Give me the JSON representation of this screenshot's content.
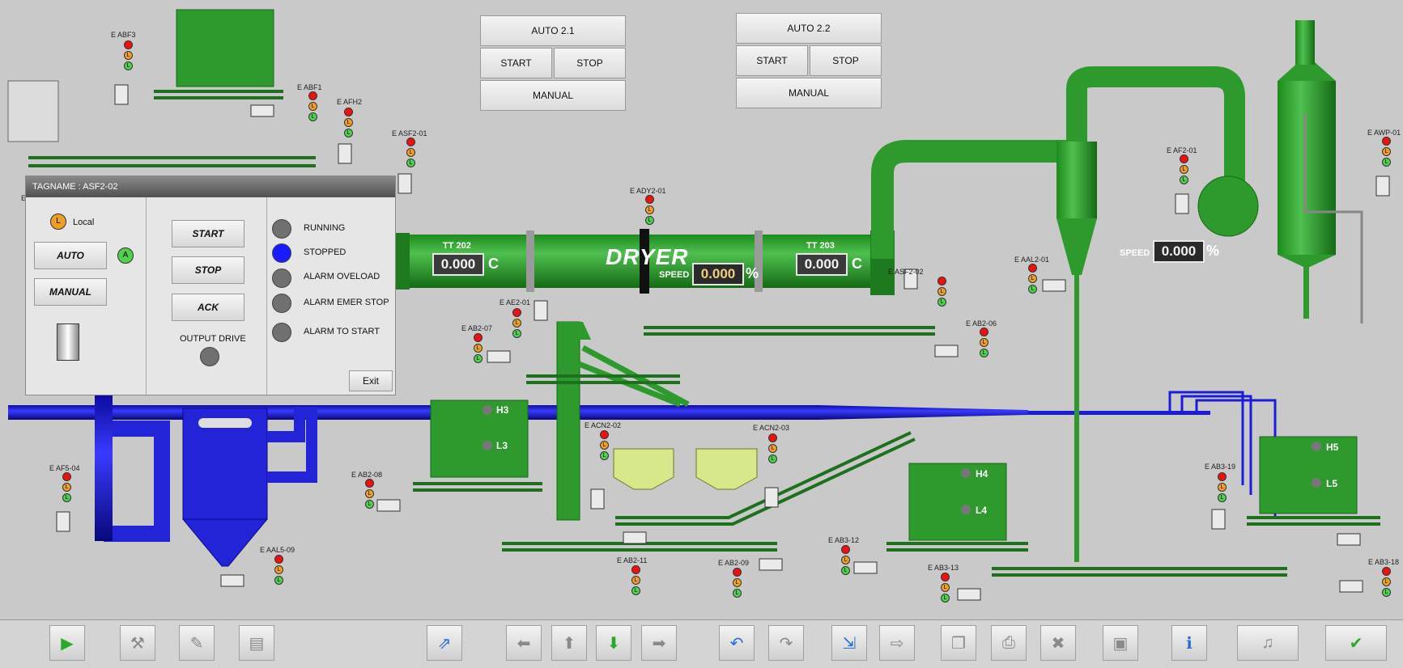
{
  "auto_panels": [
    {
      "title": "AUTO 2.1",
      "start": "START",
      "stop": "STOP",
      "manual": "MANUAL"
    },
    {
      "title": "AUTO 2.2",
      "start": "START",
      "stop": "STOP",
      "manual": "MANUAL"
    }
  ],
  "dryer": {
    "label": "DRYER",
    "speed_label": "SPEED",
    "speed_value": "0.000",
    "speed_unit": "%",
    "tt202": {
      "label": "TT 202",
      "value": "0.000",
      "unit": "C"
    },
    "tt203": {
      "label": "TT 203",
      "value": "0.000",
      "unit": "C"
    }
  },
  "fan_speed": {
    "label": "SPEED",
    "value": "0.000",
    "unit": "%"
  },
  "lamp_letter": "L",
  "auto_indicator": "A",
  "tags": {
    "abf3": "E ABF3",
    "abf1": "E ABF1",
    "afh2": "E AFH2",
    "asf201": "E ASF2-01",
    "ady201": "E ADY2-01",
    "ae201": "E AE2-01",
    "ab207": "E AB2-07",
    "asf202": "E ASF2-02",
    "ab206": "E AB2-06",
    "aal201": "E AAL2-01",
    "af201": "E AF2-01",
    "awp01": "E AWP-01",
    "acn202": "E ACN2-02",
    "acn203": "E ACN2-03",
    "ab208": "E AB2-08",
    "af504": "E AF5-04",
    "aal509": "E AAL5-09",
    "ab211": "E AB2-11",
    "ab209": "E AB2-09",
    "ab312": "E AB3-12",
    "ab313": "E AB3-13",
    "ab319": "E AB3-19",
    "ab318": "E AB3-18",
    "e_cut": "E"
  },
  "hoppers": {
    "h3": "H3",
    "l3": "L3",
    "h4": "H4",
    "l4": "L4",
    "h5": "H5",
    "l5": "L5"
  },
  "dialog": {
    "title": "TAGNAME : ASF2-02",
    "local_label": "Local",
    "auto_label": "AUTO",
    "manual_label": "MANUAL",
    "start_label": "START",
    "stop_label": "STOP",
    "ack_label": "ACK",
    "output_drive_label": "OUTPUT DRIVE",
    "statuses": [
      "RUNNING",
      "STOPPED",
      "ALARM OVELOAD",
      "ALARM EMER STOP",
      "ALARM TO START"
    ],
    "exit_label": "Exit"
  },
  "toolbar": {
    "icons": [
      "play-icon",
      "tools-icon",
      "new-report-icon",
      "report-list-icon",
      "export-screen-icon",
      "arrow-left-icon",
      "arrow-up-icon",
      "arrow-down-icon",
      "arrow-right-icon",
      "undo-icon",
      "redo-icon",
      "import-screen-icon",
      "forward-icon",
      "copy-icon",
      "print-icon",
      "delete-icon",
      "monitor-icon",
      "info-icon",
      "sound-icon",
      "acknowledge-all-icon"
    ]
  },
  "colors": {
    "equipment_green": "#2e9a2e",
    "pipe_blue": "#1c1cd6",
    "background": "#c9c9c9",
    "stopped_blue": "#1a1aff"
  }
}
